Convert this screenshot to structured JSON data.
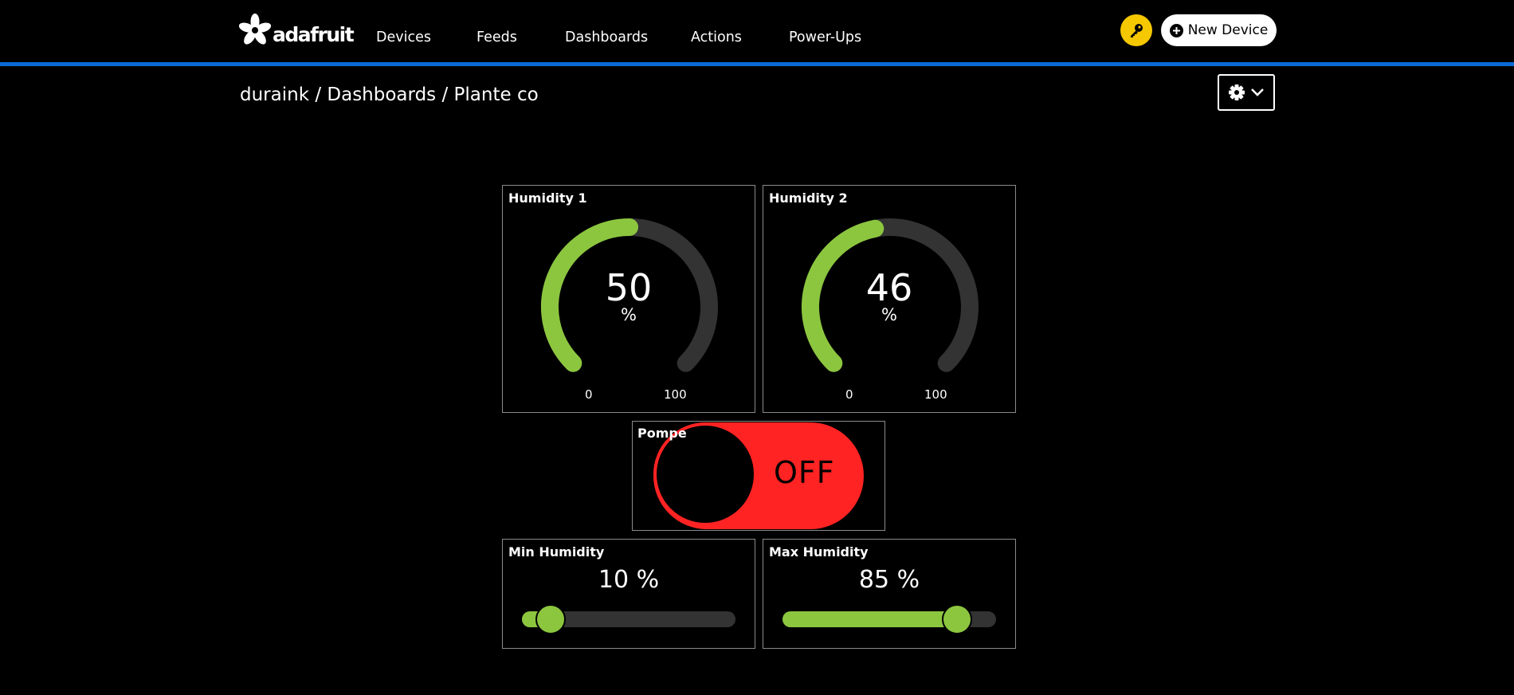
{
  "header": {
    "logo_text": "adafruit",
    "nav": [
      "Devices",
      "Feeds",
      "Dashboards",
      "Actions",
      "Power-Ups"
    ],
    "new_device_label": "New Device",
    "accent_color": "#0b6bd6",
    "key_button_color": "#f6c800",
    "icons": [
      "adafruit-flower-icon",
      "key-icon",
      "plus-circle-icon"
    ]
  },
  "breadcrumb": {
    "user": "duraink",
    "sep1": " / ",
    "section": "Dashboards",
    "sep2": " / ",
    "dashboard": "Plante co"
  },
  "settings": {
    "icons": [
      "gear-icon",
      "chevron-down-icon"
    ]
  },
  "blocks": {
    "humidity1": {
      "title": "Humidity 1",
      "value": "50",
      "unit": "%",
      "min": "0",
      "max": "100",
      "fraction": 0.5
    },
    "humidity2": {
      "title": "Humidity 2",
      "value": "46",
      "unit": "%",
      "min": "0",
      "max": "100",
      "fraction": 0.46
    },
    "pompe": {
      "title": "Pompe",
      "state": "OFF",
      "color": "#ff2323"
    },
    "min_humidity": {
      "title": "Min Humidity",
      "value_text": "10 %",
      "fraction": 0.1
    },
    "max_humidity": {
      "title": "Max Humidity",
      "value_text": "85 %",
      "fraction": 0.85
    }
  },
  "colors": {
    "gauge_fill": "#8cc63f",
    "gauge_track": "#333333",
    "toggle_off": "#ff2323"
  }
}
